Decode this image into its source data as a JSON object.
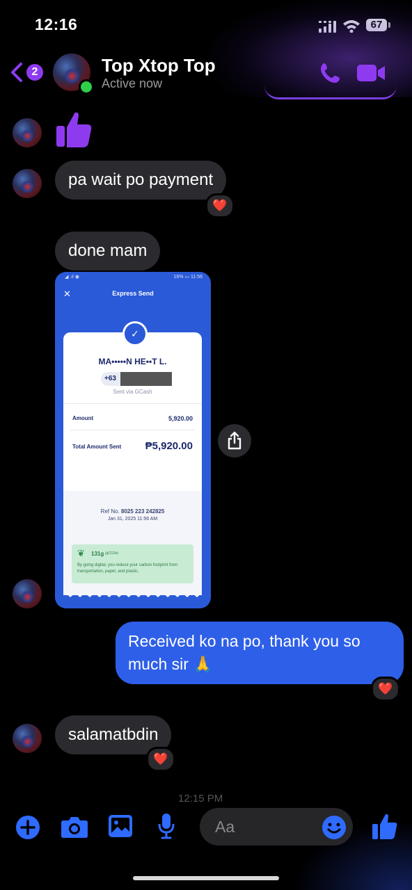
{
  "status_bar": {
    "time": "12:16",
    "battery": "67"
  },
  "header": {
    "back_badge": "2",
    "contact_name": "Top Xtop Top",
    "contact_status": "Active now"
  },
  "messages": {
    "thumbs_up_sticker": "thumbs-up",
    "m1": {
      "text": "pa wait po payment",
      "reaction": "❤️"
    },
    "m2": {
      "text": "done mam"
    },
    "m3": {
      "text": "Received ko na po, thank you so much sir 🙏",
      "reaction": "❤️"
    },
    "m4": {
      "text": "salamatbdin",
      "reaction": "❤️"
    },
    "timestamp_partial": "12:15 PM"
  },
  "receipt": {
    "status_left": "◢ .ıl ◉",
    "status_right": "16% ▭ 11:56",
    "title": "Express Send",
    "recipient": "MA•••••N HE••T L.",
    "phone_prefix": "+63",
    "sent_via": "Sent via GCash",
    "amount_label": "Amount",
    "amount_value": "5,920.00",
    "total_label": "Total Amount Sent",
    "total_value": "₱5,920.00",
    "ref_label": "Ref No.",
    "ref_value": "8025 223 242825",
    "date": "Jan 31, 2025 11:56 AM",
    "carbon_value": "131g",
    "carbon_unit": "(gCO2e)",
    "carbon_text": "By going digital, you reduce your carbon footprint from transportation, paper, and plastic."
  },
  "composer": {
    "placeholder": "Aa"
  },
  "colors": {
    "accent": "#8e3bf0",
    "outgoing_bubble": "#2e5fe8",
    "incoming_bubble": "#2b2b2f",
    "toolbar_blue": "#2f6bff"
  }
}
